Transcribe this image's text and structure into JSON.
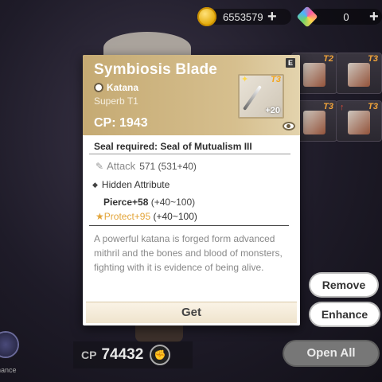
{
  "currency": {
    "gold": {
      "icon": "gold-coin-icon",
      "value": "6553579"
    },
    "gem": {
      "icon": "gem-icon",
      "value": "0"
    }
  },
  "inventory": {
    "slots": [
      {
        "tier": "T2",
        "upgrade": false
      },
      {
        "tier": "T3",
        "upgrade": false
      },
      {
        "tier": "T3",
        "upgrade": true
      },
      {
        "tier": "T3",
        "upgrade": true
      }
    ]
  },
  "tooltip": {
    "name": "Symbiosis Blade",
    "badge": "E",
    "type": "Katana",
    "rarity": "Superb T1",
    "cp": "CP: 1943",
    "thumb_tier": "T3",
    "thumb_level": "+20",
    "seal": "Seal required: Seal of Mutualism III",
    "attack_label": "Attack",
    "attack_value": "571 (531+40)",
    "hidden_label": "Hidden Attribute",
    "pierce_name": "Pierce+58",
    "pierce_range": "(+40~100)",
    "protect_star": "★",
    "protect_name": "Protect+95",
    "protect_range": "(+40~100)",
    "description": "A powerful katana is forged form advanced mithril and the bones and blood of monsters, fighting with it is evidence of being alive.",
    "get_label": "Get"
  },
  "actions": {
    "remove": "Remove",
    "enhance": "Enhance",
    "open_all": "Open All"
  },
  "footer": {
    "cp_label": "CP",
    "cp_value": "74432",
    "enhance_label": "nance"
  }
}
